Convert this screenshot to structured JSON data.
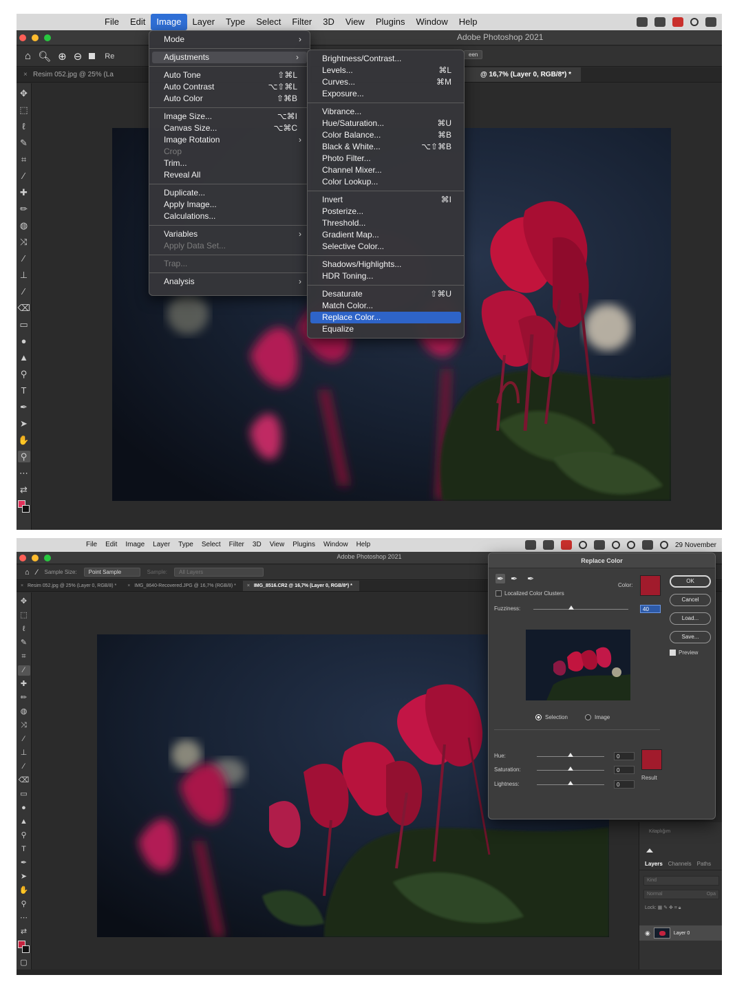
{
  "menubar": {
    "items": [
      "File",
      "Edit",
      "Image",
      "Layer",
      "Type",
      "Select",
      "Filter",
      "3D",
      "View",
      "Plugins",
      "Window",
      "Help"
    ],
    "active": "Image",
    "clock": "29 November"
  },
  "app_title": "Adobe Photoshop 2021",
  "shot1": {
    "tabs": [
      "Resim 052.jpg @ 25% (La",
      "@ 16,7% (Layer 0, RGB/8*) *"
    ],
    "options_fragment": "Re",
    "options_fragment2": "een"
  },
  "image_menu": {
    "items": [
      {
        "label": "Mode",
        "shortcut": "",
        "submenu": true,
        "disabled": false
      },
      {
        "sep": true
      },
      {
        "label": "Adjustments",
        "shortcut": "",
        "submenu": true,
        "disabled": false,
        "open": true
      },
      {
        "sep": true
      },
      {
        "label": "Auto Tone",
        "shortcut": "⇧⌘L",
        "submenu": false,
        "disabled": false
      },
      {
        "label": "Auto Contrast",
        "shortcut": "⌥⇧⌘L",
        "submenu": false,
        "disabled": false
      },
      {
        "label": "Auto Color",
        "shortcut": "⇧⌘B",
        "submenu": false,
        "disabled": false
      },
      {
        "sep": true
      },
      {
        "label": "Image Size...",
        "shortcut": "⌥⌘I",
        "submenu": false,
        "disabled": false
      },
      {
        "label": "Canvas Size...",
        "shortcut": "⌥⌘C",
        "submenu": false,
        "disabled": false
      },
      {
        "label": "Image Rotation",
        "shortcut": "",
        "submenu": true,
        "disabled": false
      },
      {
        "label": "Crop",
        "shortcut": "",
        "submenu": false,
        "disabled": true
      },
      {
        "label": "Trim...",
        "shortcut": "",
        "submenu": false,
        "disabled": false
      },
      {
        "label": "Reveal All",
        "shortcut": "",
        "submenu": false,
        "disabled": false
      },
      {
        "sep": true
      },
      {
        "label": "Duplicate...",
        "shortcut": "",
        "submenu": false,
        "disabled": false
      },
      {
        "label": "Apply Image...",
        "shortcut": "",
        "submenu": false,
        "disabled": false
      },
      {
        "label": "Calculations...",
        "shortcut": "",
        "submenu": false,
        "disabled": false
      },
      {
        "sep": true
      },
      {
        "label": "Variables",
        "shortcut": "",
        "submenu": true,
        "disabled": false
      },
      {
        "label": "Apply Data Set...",
        "shortcut": "",
        "submenu": false,
        "disabled": true
      },
      {
        "sep": true
      },
      {
        "label": "Trap...",
        "shortcut": "",
        "submenu": false,
        "disabled": true
      },
      {
        "sep": true
      },
      {
        "label": "Analysis",
        "shortcut": "",
        "submenu": true,
        "disabled": false
      }
    ]
  },
  "adjustments_menu": {
    "items": [
      {
        "label": "Brightness/Contrast...",
        "shortcut": ""
      },
      {
        "label": "Levels...",
        "shortcut": "⌘L"
      },
      {
        "label": "Curves...",
        "shortcut": "⌘M"
      },
      {
        "label": "Exposure...",
        "shortcut": ""
      },
      {
        "sep": true
      },
      {
        "label": "Vibrance...",
        "shortcut": ""
      },
      {
        "label": "Hue/Saturation...",
        "shortcut": "⌘U"
      },
      {
        "label": "Color Balance...",
        "shortcut": "⌘B"
      },
      {
        "label": "Black & White...",
        "shortcut": "⌥⇧⌘B"
      },
      {
        "label": "Photo Filter...",
        "shortcut": ""
      },
      {
        "label": "Channel Mixer...",
        "shortcut": ""
      },
      {
        "label": "Color Lookup...",
        "shortcut": ""
      },
      {
        "sep": true
      },
      {
        "label": "Invert",
        "shortcut": "⌘I"
      },
      {
        "label": "Posterize...",
        "shortcut": ""
      },
      {
        "label": "Threshold...",
        "shortcut": ""
      },
      {
        "label": "Gradient Map...",
        "shortcut": ""
      },
      {
        "label": "Selective Color...",
        "shortcut": ""
      },
      {
        "sep": true
      },
      {
        "label": "Shadows/Highlights...",
        "shortcut": ""
      },
      {
        "label": "HDR Toning...",
        "shortcut": ""
      },
      {
        "sep": true
      },
      {
        "label": "Desaturate",
        "shortcut": "⇧⌘U"
      },
      {
        "label": "Match Color...",
        "shortcut": ""
      },
      {
        "label": "Replace Color...",
        "shortcut": "",
        "highlighted": true
      },
      {
        "label": "Equalize",
        "shortcut": ""
      }
    ]
  },
  "shot2": {
    "options": {
      "sample_size_label": "Sample Size:",
      "sample_size_value": "Point Sample",
      "sample_label": "Sample:",
      "sample_value": "All Layers"
    },
    "tabs": [
      "Resim 052.jpg @ 25% (Layer 0, RGB/8) *",
      "IMG_8640-Recovered.JPG @ 16,7% (RGB/8) *",
      "IMG_8516.CR2 @ 16,7% (Layer 0, RGB/8*) *"
    ],
    "active_tab": 2
  },
  "replace_color": {
    "title": "Replace Color",
    "localized_clusters_label": "Localized Color Clusters",
    "localized_clusters_checked": false,
    "color_label": "Color:",
    "fuzziness_label": "Fuzziness:",
    "fuzziness_value": "40",
    "fuzziness_fraction": 0.4,
    "selection_label": "Selection",
    "image_label": "Image",
    "mode": "Selection",
    "hue_label": "Hue:",
    "hue_value": "0",
    "saturation_label": "Saturation:",
    "saturation_value": "0",
    "lightness_label": "Lightness:",
    "lightness_value": "0",
    "result_label": "Result",
    "ok_label": "OK",
    "cancel_label": "Cancel",
    "load_label": "Load...",
    "save_label": "Save...",
    "preview_label": "Preview",
    "preview_checked": true,
    "swatch_color": "#a11b2c"
  },
  "panels": {
    "library_label": "Kitaplığım",
    "tabs": [
      "Layers",
      "Channels",
      "Paths"
    ],
    "active_tab": "Layers",
    "kind_placeholder": "Kind",
    "blend_mode": "Normal",
    "blend_mode_right": "Opa",
    "lock_label": "Lock:",
    "layer_name": "Layer 0"
  },
  "colors": {
    "menu_highlight": "#2e64c8",
    "foreground_swatch": "#e0315a",
    "replace_swatch": "#a11b2c"
  }
}
